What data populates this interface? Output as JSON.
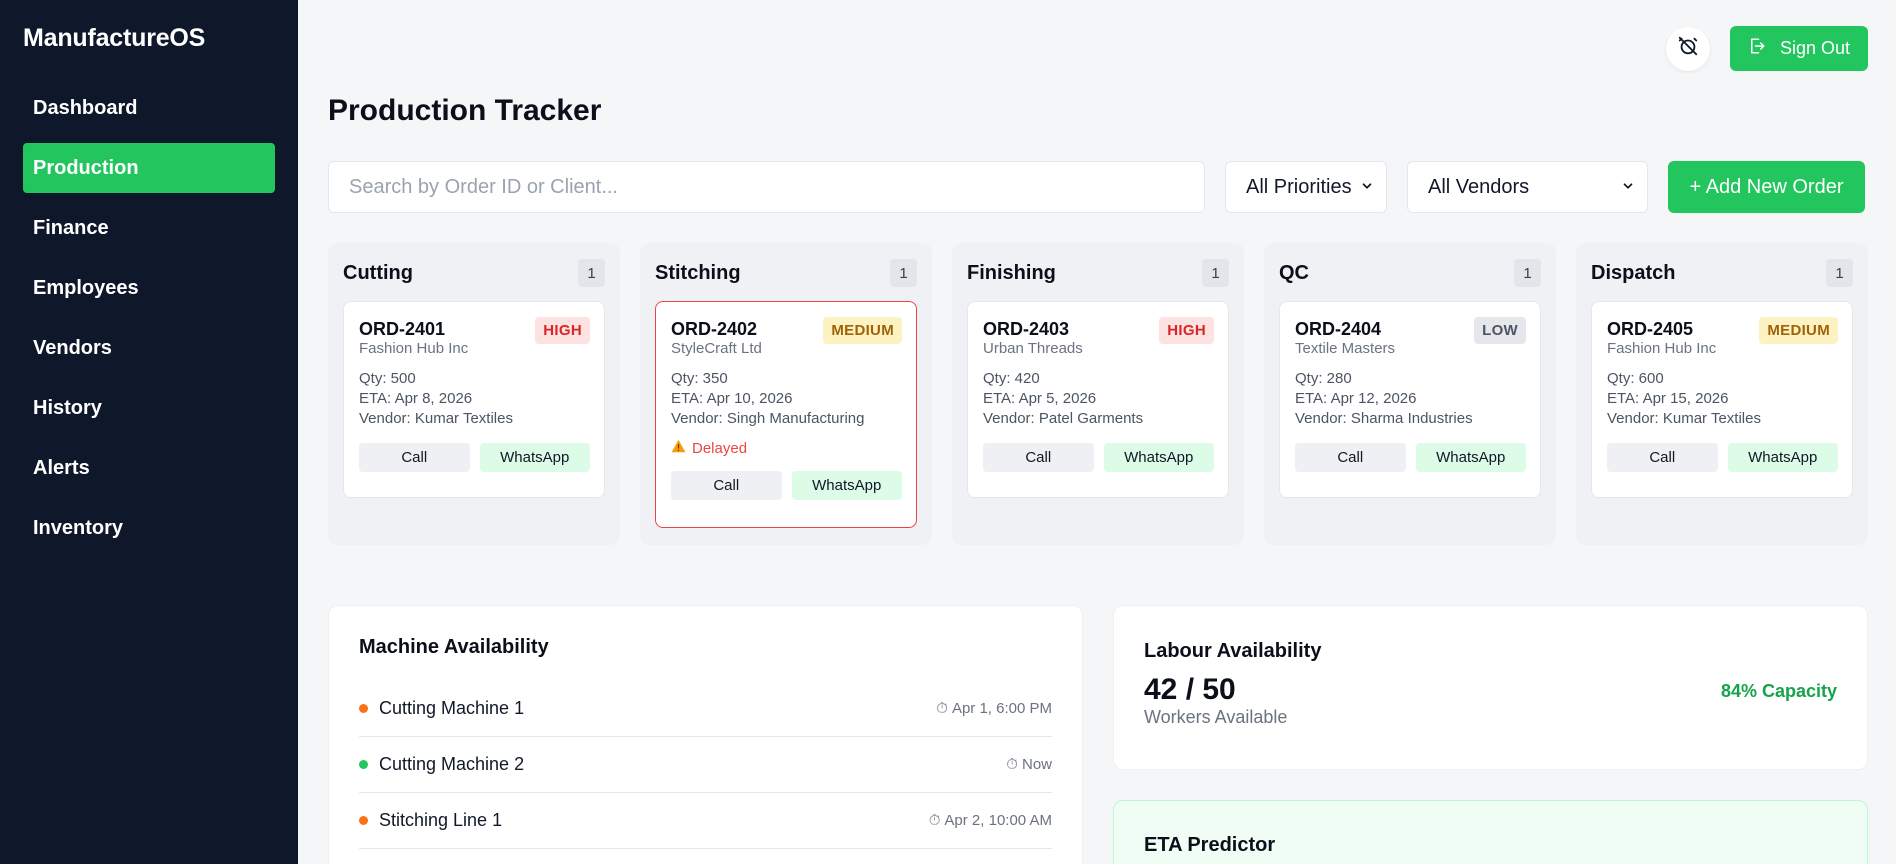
{
  "app": {
    "brand": "ManufactureOS"
  },
  "sidebar": {
    "items": [
      {
        "label": "Dashboard",
        "active": false
      },
      {
        "label": "Production",
        "active": true
      },
      {
        "label": "Finance",
        "active": false
      },
      {
        "label": "Employees",
        "active": false
      },
      {
        "label": "Vendors",
        "active": false
      },
      {
        "label": "History",
        "active": false
      },
      {
        "label": "Alerts",
        "active": false
      },
      {
        "label": "Inventory",
        "active": false
      }
    ]
  },
  "header": {
    "icon": "alarm-off-icon",
    "signout_label": "Sign Out",
    "signout_icon": "sign-out-icon"
  },
  "page": {
    "title": "Production Tracker"
  },
  "filters": {
    "search_placeholder": "Search by Order ID or Client...",
    "search_value": "",
    "priority_selected": "All Priorities",
    "vendor_selected": "All Vendors",
    "add_label": "+ Add New Order"
  },
  "columns": [
    {
      "title": "Cutting",
      "count": "1",
      "card": {
        "id": "ORD-2401",
        "priority": "HIGH",
        "client": "Fashion Hub Inc",
        "qty": "Qty: 500",
        "eta": "ETA: Apr 8, 2026",
        "vendor": "Vendor: Kumar Textiles",
        "delayed": false,
        "call": "Call",
        "whatsapp": "WhatsApp"
      }
    },
    {
      "title": "Stitching",
      "count": "1",
      "card": {
        "id": "ORD-2402",
        "priority": "MEDIUM",
        "client": "StyleCraft Ltd",
        "qty": "Qty: 350",
        "eta": "ETA: Apr 10, 2026",
        "vendor": "Vendor: Singh Manufacturing",
        "delayed": true,
        "delay_label": "Delayed",
        "call": "Call",
        "whatsapp": "WhatsApp"
      }
    },
    {
      "title": "Finishing",
      "count": "1",
      "card": {
        "id": "ORD-2403",
        "priority": "HIGH",
        "client": "Urban Threads",
        "qty": "Qty: 420",
        "eta": "ETA: Apr 5, 2026",
        "vendor": "Vendor: Patel Garments",
        "delayed": false,
        "call": "Call",
        "whatsapp": "WhatsApp"
      }
    },
    {
      "title": "QC",
      "count": "1",
      "card": {
        "id": "ORD-2404",
        "priority": "LOW",
        "client": "Textile Masters",
        "qty": "Qty: 280",
        "eta": "ETA: Apr 12, 2026",
        "vendor": "Vendor: Sharma Industries",
        "delayed": false,
        "call": "Call",
        "whatsapp": "WhatsApp"
      }
    },
    {
      "title": "Dispatch",
      "count": "1",
      "card": {
        "id": "ORD-2405",
        "priority": "MEDIUM",
        "client": "Fashion Hub Inc",
        "qty": "Qty: 600",
        "eta": "ETA: Apr 15, 2026",
        "vendor": "Vendor: Kumar Textiles",
        "delayed": false,
        "call": "Call",
        "whatsapp": "WhatsApp"
      }
    }
  ],
  "machines": {
    "title": "Machine Availability",
    "rows": [
      {
        "name": "Cutting Machine 1",
        "time": "Apr 1, 6:00 PM",
        "status_color": "#f97316"
      },
      {
        "name": "Cutting Machine 2",
        "time": "Now",
        "status_color": "#22c55e"
      },
      {
        "name": "Stitching Line 1",
        "time": "Apr 2, 10:00 AM",
        "status_color": "#f97316"
      }
    ]
  },
  "labour": {
    "title": "Labour Availability",
    "value": "42 / 50",
    "subtitle": "Workers Available",
    "capacity": "84% Capacity"
  },
  "eta": {
    "title": "ETA Predictor"
  },
  "colors": {
    "sidebar_bg": "#0f172a",
    "accent": "#22c55e",
    "danger": "#ef4444"
  }
}
